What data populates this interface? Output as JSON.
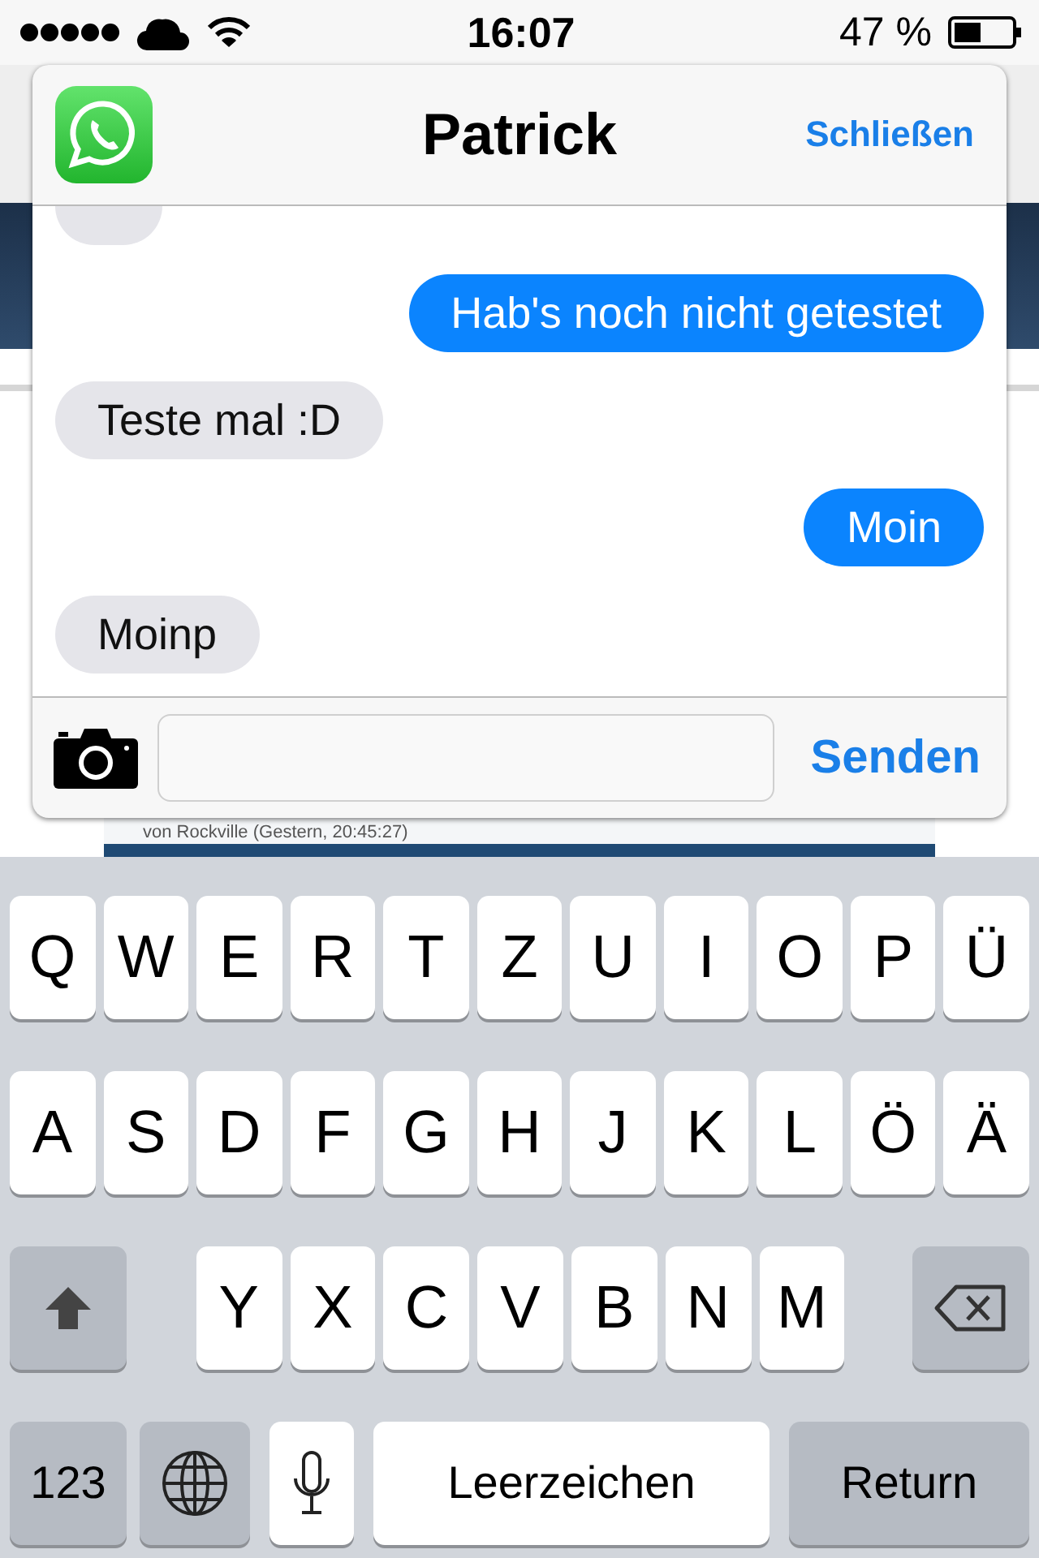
{
  "status_bar": {
    "time": "16:07",
    "battery_text": "47 %"
  },
  "background_page": {
    "byline": "von Rockville (Gestern, 20:45:27)"
  },
  "popup": {
    "title": "Patrick",
    "close_label": "Schließen",
    "messages": [
      {
        "kind": "received"
      },
      {
        "kind": "sent",
        "text": "Hab's noch nicht getestet"
      },
      {
        "kind": "received",
        "text": "Teste mal :D"
      },
      {
        "kind": "sent",
        "text": "Moin"
      },
      {
        "kind": "received",
        "text": "Moinp"
      }
    ],
    "send_label": "Senden"
  },
  "keyboard": {
    "rows": [
      {
        "keys": [
          {
            "kind": "letter",
            "label": "Q"
          },
          {
            "kind": "letter",
            "label": "W"
          },
          {
            "kind": "letter",
            "label": "E"
          },
          {
            "kind": "letter",
            "label": "R"
          },
          {
            "kind": "letter",
            "label": "T"
          },
          {
            "kind": "letter",
            "label": "Z"
          },
          {
            "kind": "letter",
            "label": "U"
          },
          {
            "kind": "letter",
            "label": "I"
          },
          {
            "kind": "letter",
            "label": "O"
          },
          {
            "kind": "letter",
            "label": "P"
          },
          {
            "kind": "letter",
            "label": "Ü"
          }
        ]
      },
      {
        "keys": [
          {
            "kind": "letter",
            "label": "A"
          },
          {
            "kind": "letter",
            "label": "S"
          },
          {
            "kind": "letter",
            "label": "D"
          },
          {
            "kind": "letter",
            "label": "F"
          },
          {
            "kind": "letter",
            "label": "G"
          },
          {
            "kind": "letter",
            "label": "H"
          },
          {
            "kind": "letter",
            "label": "J"
          },
          {
            "kind": "letter",
            "label": "K"
          },
          {
            "kind": "letter",
            "label": "L"
          },
          {
            "kind": "letter",
            "label": "Ö"
          },
          {
            "kind": "letter",
            "label": "Ä"
          }
        ]
      },
      {
        "keys": [
          {
            "kind": "shift"
          },
          {
            "kind": "letter",
            "label": "Y"
          },
          {
            "kind": "letter",
            "label": "X"
          },
          {
            "kind": "letter",
            "label": "C"
          },
          {
            "kind": "letter",
            "label": "V"
          },
          {
            "kind": "letter",
            "label": "B"
          },
          {
            "kind": "letter",
            "label": "N"
          },
          {
            "kind": "letter",
            "label": "M"
          },
          {
            "kind": "backspace"
          }
        ]
      },
      {
        "keys": [
          {
            "kind": "numbers",
            "label": "123"
          },
          {
            "kind": "globe"
          },
          {
            "kind": "mic"
          },
          {
            "kind": "space",
            "label": "Leerzeichen"
          },
          {
            "kind": "return",
            "label": "Return"
          }
        ]
      }
    ]
  }
}
